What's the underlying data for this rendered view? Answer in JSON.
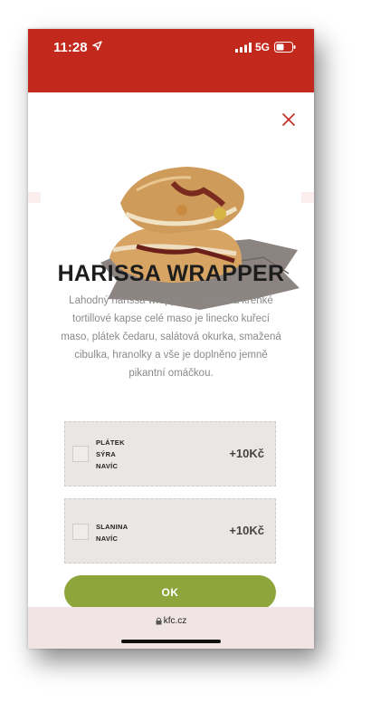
{
  "status_bar": {
    "time": "11:28",
    "network": "5G",
    "icons": [
      "location-arrow-icon",
      "signal-icon",
      "battery-icon"
    ],
    "color": "#c3281c"
  },
  "modal": {
    "close_icon": "close-icon",
    "product": {
      "title": "HARISSA WRAPPER",
      "description": "Lahodný harissa wrapper v čerstvé a křehké tortillové kapse celé maso je linecko kuřecí maso, plátek čedaru, salátová okurka, smažená cibulka, hranolky a vše je doplněno jemně pikantní omáčkou."
    },
    "options": [
      {
        "label": "PLÁTEK SÝRA NAVÍC",
        "price": "+10Kč",
        "checked": false
      },
      {
        "label": "SLANINA NAVÍC",
        "price": "+10Kč",
        "checked": false
      }
    ],
    "ok_button": "OK",
    "accent_color": "#8da53a"
  },
  "browser": {
    "url": "kfc.cz",
    "lock_icon": "lock-icon"
  }
}
